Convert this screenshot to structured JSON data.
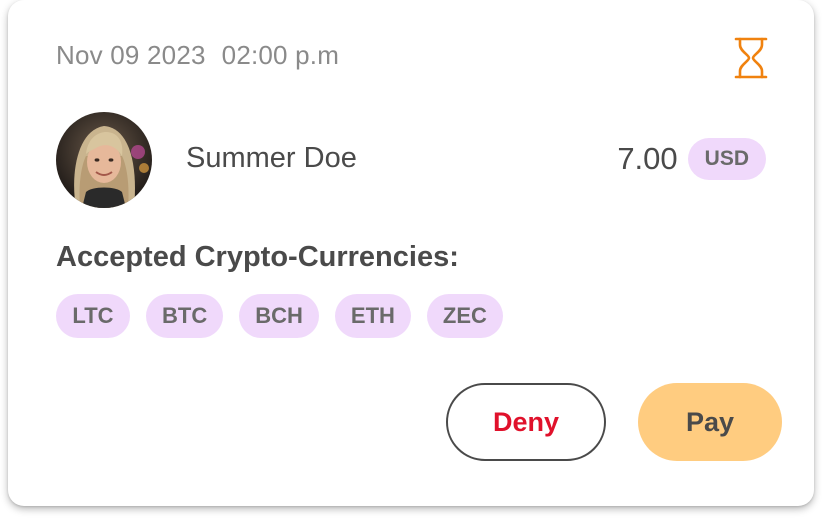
{
  "transaction": {
    "date": "Nov 09 2023",
    "time": "02:00 p.m",
    "status_icon": "hourglass-icon",
    "user_name": "Summer Doe",
    "amount": "7.00",
    "currency": "USD"
  },
  "accepted": {
    "label": "Accepted Crypto-Currencies:",
    "currencies": [
      "LTC",
      "BTC",
      "BCH",
      "ETH",
      "ZEC"
    ]
  },
  "actions": {
    "deny_label": "Deny",
    "pay_label": "Pay"
  },
  "colors": {
    "accent_orange": "#f0820f",
    "pill_bg": "#f0d9fb",
    "deny_red": "#e0112b",
    "pay_bg": "#ffcc80",
    "text_dark": "#4a4a4a",
    "text_muted": "#8a8a8a"
  }
}
